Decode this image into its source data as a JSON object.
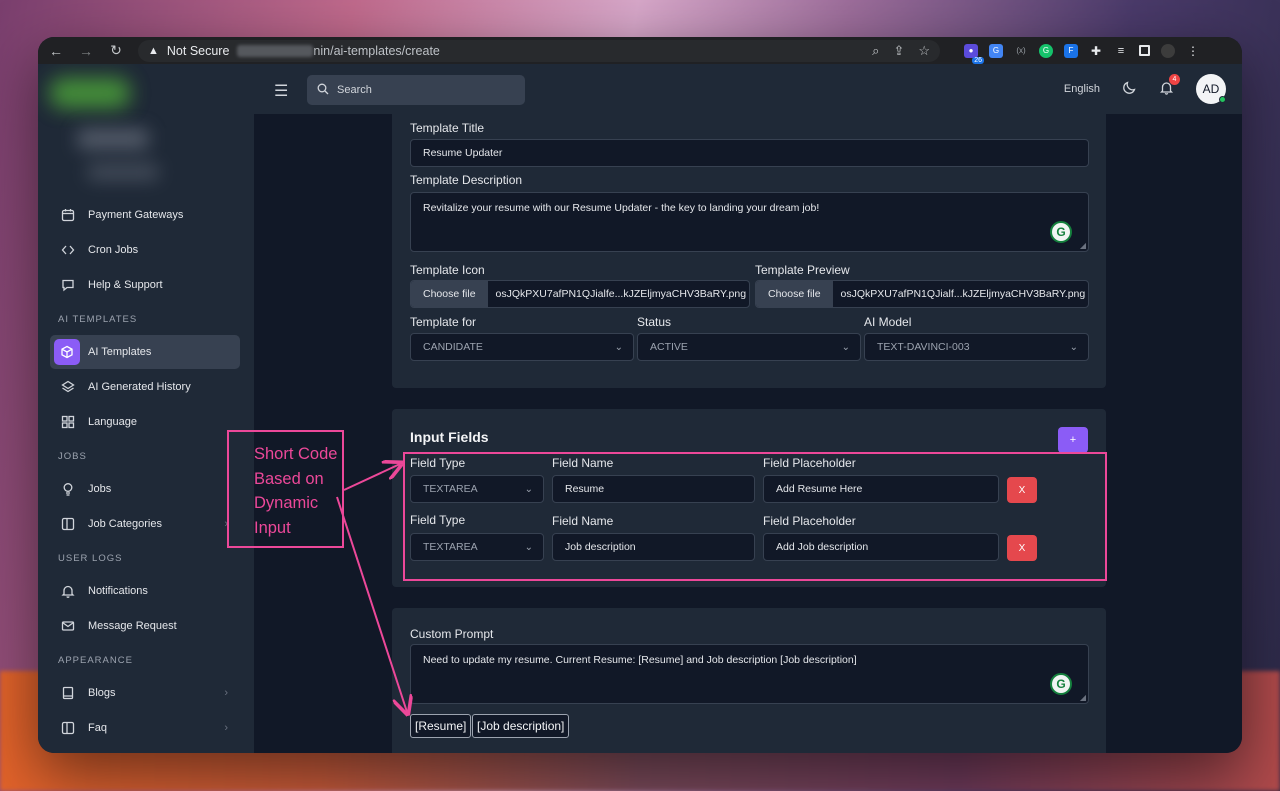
{
  "browser": {
    "security_label": "Not Secure",
    "url_path": "nin/ai-templates/create",
    "extension_badge": "26"
  },
  "sidebar": {
    "items_top": [
      {
        "label": "Payment Gateways",
        "icon": "calendar-icon"
      },
      {
        "label": "Cron Jobs",
        "icon": "code-icon"
      },
      {
        "label": "Help & Support",
        "icon": "chat-icon"
      }
    ],
    "section_ai": "AI TEMPLATES",
    "items_ai": [
      {
        "label": "AI Templates",
        "icon": "cube-icon",
        "active": true
      },
      {
        "label": "AI Generated History",
        "icon": "layers-icon"
      },
      {
        "label": "Language",
        "icon": "grid-icon"
      }
    ],
    "section_jobs": "JOBS",
    "items_jobs": [
      {
        "label": "Jobs",
        "icon": "bulb-icon"
      },
      {
        "label": "Job Categories",
        "icon": "columns-icon"
      }
    ],
    "section_user_logs": "USER LOGS",
    "items_logs": [
      {
        "label": "Notifications",
        "icon": "bell-icon"
      },
      {
        "label": "Message Request",
        "icon": "mail-icon"
      }
    ],
    "section_appearance": "APPEARANCE",
    "items_appearance": [
      {
        "label": "Blogs",
        "icon": "book-icon"
      },
      {
        "label": "Faq",
        "icon": "columns-icon"
      }
    ]
  },
  "header": {
    "search_placeholder": "Search",
    "language": "English",
    "notification_count": "4",
    "avatar_initials": "AD"
  },
  "template_form": {
    "title_label": "Template Title",
    "title_value": "Resume Updater",
    "description_label": "Template Description",
    "description_value": "Revitalize your resume with our Resume Updater - the key to landing your dream job!",
    "icon_label": "Template Icon",
    "icon_button": "Choose file",
    "icon_file": "osJQkPXU7afPN1QJialfe...kJZEljmyaCHV3BaRY.png",
    "preview_label": "Template Preview",
    "preview_button": "Choose file",
    "preview_file": "osJQkPXU7afPN1QJialf...kJZEljmyaCHV3BaRY.png",
    "for_label": "Template for",
    "for_value": "CANDIDATE",
    "status_label": "Status",
    "status_value": "ACTIVE",
    "model_label": "AI Model",
    "model_value": "TEXT-DAVINCI-003"
  },
  "input_fields": {
    "title": "Input Fields",
    "add_label": "+",
    "rows": [
      {
        "type_label": "Field Type",
        "type_value": "TEXTAREA",
        "name_label": "Field Name",
        "name_value": "Resume",
        "placeholder_label": "Field Placeholder",
        "placeholder_value": "Add Resume Here",
        "remove_label": "X"
      },
      {
        "type_label": "Field Type",
        "type_value": "TEXTAREA",
        "name_label": "Field Name",
        "name_value": "Job description",
        "placeholder_label": "Field Placeholder",
        "placeholder_value": "Add Job description",
        "remove_label": "X"
      }
    ]
  },
  "custom_prompt": {
    "label": "Custom Prompt",
    "value": "Need to update my resume. Current Resume: [Resume] and Job description [Job description]",
    "shortcodes": [
      "[Resume]",
      "[Job description]"
    ]
  },
  "annotation": {
    "lines": [
      "Short Code",
      "Based on",
      "Dynamic",
      "Input"
    ],
    "color": "#ec4899"
  },
  "colors": {
    "accent": "#8b5cf6",
    "danger": "#e5484d",
    "surface": "#1f2937",
    "background": "#111827"
  }
}
